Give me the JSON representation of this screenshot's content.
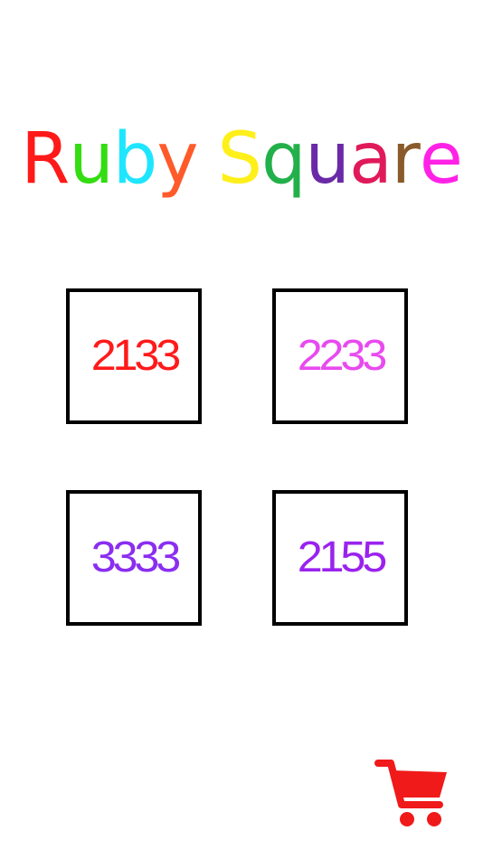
{
  "title": {
    "letters": [
      {
        "char": "R",
        "color": "#ff1a1a"
      },
      {
        "char": "u",
        "color": "#33dd11"
      },
      {
        "char": "b",
        "color": "#1ee6ff"
      },
      {
        "char": "y",
        "color": "#ff5a2a"
      },
      {
        "char": " ",
        "color": "#ffffff"
      },
      {
        "char": "S",
        "color": "#ffef1a"
      },
      {
        "char": "q",
        "color": "#22b04a"
      },
      {
        "char": "u",
        "color": "#6a2aa8"
      },
      {
        "char": "a",
        "color": "#e01a5a"
      },
      {
        "char": "r",
        "color": "#8a5a2a"
      },
      {
        "char": "e",
        "color": "#ff22e6"
      }
    ]
  },
  "tiles": [
    {
      "value": "2133",
      "color": "#ff1a1a"
    },
    {
      "value": "2233",
      "color": "#e84af0"
    },
    {
      "value": "3333",
      "color": "#8a2ef0"
    },
    {
      "value": "2155",
      "color": "#9a22ee"
    }
  ],
  "cart": {
    "icon": "shopping-cart-icon",
    "color": "#f01a1a"
  }
}
